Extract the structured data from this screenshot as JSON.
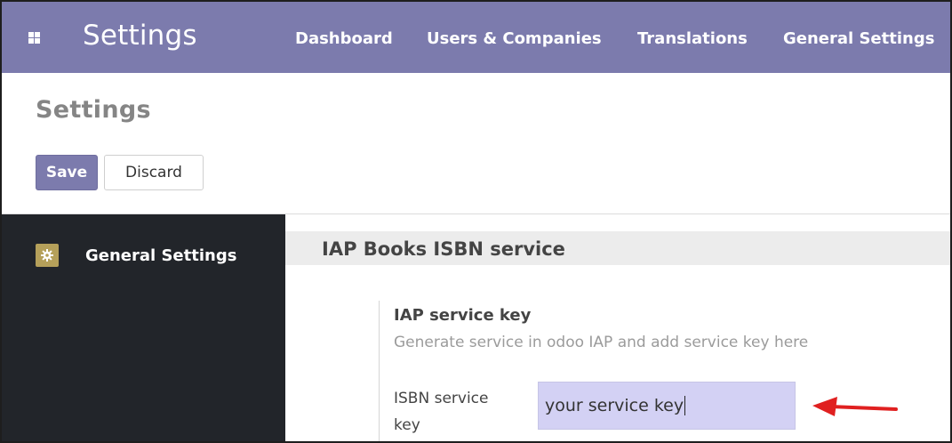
{
  "topbar": {
    "apps_icon": "grid-apps-icon",
    "title": "Settings",
    "menu": [
      {
        "label": "Dashboard"
      },
      {
        "label": "Users & Companies"
      },
      {
        "label": "Translations"
      },
      {
        "label": "General Settings"
      }
    ],
    "background": "#7c7bad"
  },
  "control_panel": {
    "breadcrumb": "Settings",
    "save_label": "Save",
    "discard_label": "Discard"
  },
  "sidebar": {
    "items": [
      {
        "label": "General Settings",
        "icon": "gear-icon",
        "icon_color": "#b5a05a"
      }
    ],
    "background": "#22252a"
  },
  "main": {
    "section_title": "IAP Books ISBN service",
    "setting": {
      "title": "IAP service key",
      "help": "Generate service in odoo IAP and add service key here",
      "field_label": "ISBN service key",
      "field_value": "your service key"
    },
    "annotation": {
      "icon": "red-arrow-icon",
      "color": "#e02020"
    }
  }
}
